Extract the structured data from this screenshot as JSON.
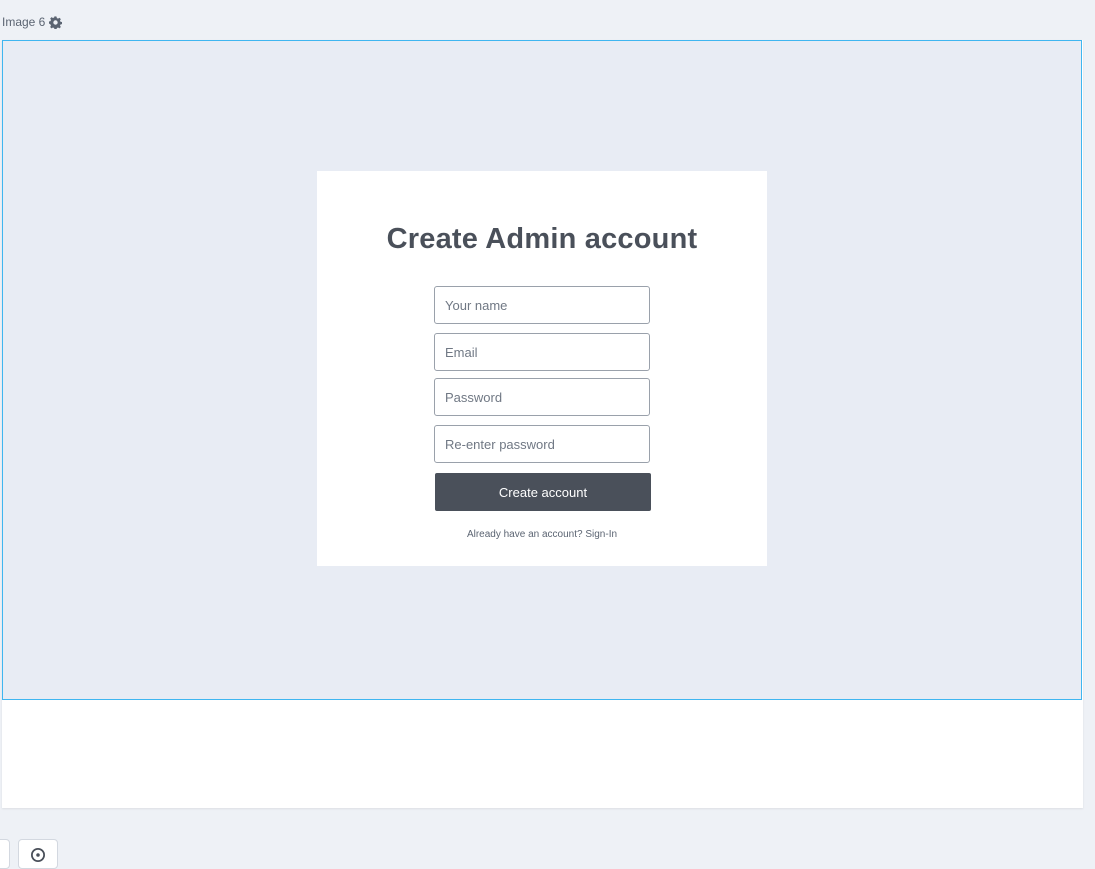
{
  "header": {
    "image_label": "Image 6",
    "settings_icon": "gear-icon"
  },
  "form": {
    "title": "Create Admin account",
    "fields": [
      {
        "placeholder": "Your name",
        "value": ""
      },
      {
        "placeholder": "Email",
        "value": ""
      },
      {
        "placeholder": "Password",
        "value": ""
      },
      {
        "placeholder": "Re-enter password",
        "value": ""
      }
    ],
    "submit_label": "Create account",
    "signin_prompt": "Already have an account? Sign-In"
  },
  "footer": {
    "help_icon": "help-icon"
  },
  "colors": {
    "page_background": "#eef1f6",
    "preview_background": "#e8ecf4",
    "selection_border": "#3fb6f0",
    "button_background": "#4a505a",
    "title_text": "#4a505a"
  }
}
